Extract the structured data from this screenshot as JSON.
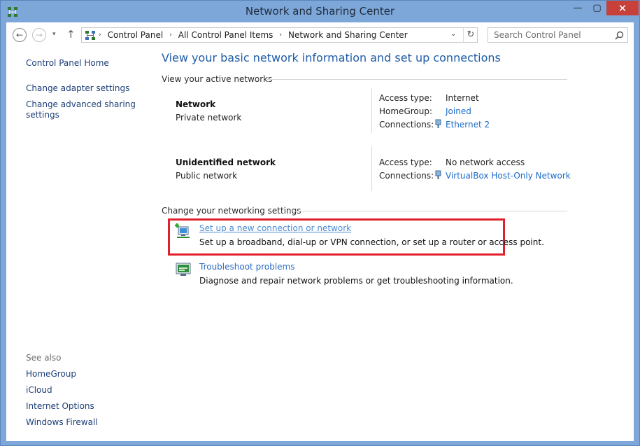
{
  "window": {
    "title": "Network and Sharing Center",
    "min_glyph": "—",
    "max_glyph": "▢",
    "close_glyph": "✕"
  },
  "nav": {
    "back_glyph": "←",
    "forward_glyph": "→",
    "recent_glyph": "▾",
    "up_glyph": "↑"
  },
  "address": {
    "crumbs": [
      "Control Panel",
      "All Control Panel Items",
      "Network and Sharing Center"
    ],
    "separator": "›",
    "dropdown_glyph": "⌄",
    "refresh_glyph": "↻"
  },
  "search": {
    "placeholder": "Search Control Panel"
  },
  "sidebar": {
    "home": "Control Panel Home",
    "adapter": "Change adapter settings",
    "advanced_line1": "Change advanced sharing",
    "advanced_line2": "settings",
    "see_also": "See also",
    "links": [
      "HomeGroup",
      "iCloud",
      "Internet Options",
      "Windows Firewall"
    ]
  },
  "main": {
    "heading": "View your basic network information and set up connections",
    "active_label": "View your active networks",
    "networks": [
      {
        "name": "Network",
        "type": "Private network",
        "rows": [
          {
            "key": "Access type:",
            "value": "Internet",
            "link": false
          },
          {
            "key": "HomeGroup:",
            "value": "Joined",
            "link": true
          },
          {
            "key": "Connections:",
            "value": "Ethernet 2",
            "link": true
          }
        ]
      },
      {
        "name": "Unidentified network",
        "type": "Public network",
        "rows": [
          {
            "key": "Access type:",
            "value": "No network access",
            "link": false
          },
          {
            "key": "Connections:",
            "value": "VirtualBox Host-Only Network",
            "link": true
          }
        ]
      }
    ],
    "change_label": "Change your networking settings",
    "tasks": [
      {
        "title": "Set up a new connection or network",
        "desc": "Set up a broadband, dial-up or VPN connection, or set up a router or access point."
      },
      {
        "title": "Troubleshoot problems",
        "desc": "Diagnose and repair network problems or get troubleshooting information."
      }
    ]
  },
  "colors": {
    "titlebar": "#7da7d9",
    "link": "#1a6bc9",
    "highlight": "#e0202c",
    "close": "#c7403a"
  }
}
